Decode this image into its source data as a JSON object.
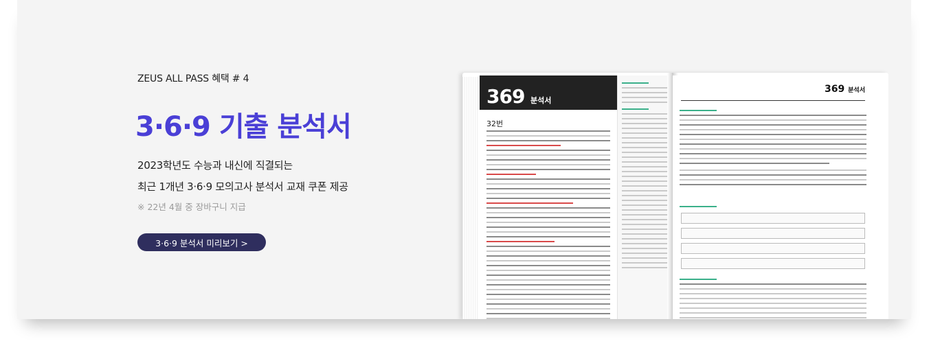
{
  "banner": {
    "label": "ZEUS ALL PASS 혜택  # 4",
    "title": "3·6·9 기출 분석서",
    "desc_line1": "2023학년도 수능과 내신에 직결되는",
    "desc_line2": "최근 1개년 3·6·9 모의고사 분석서 교재 쿠폰 제공",
    "note": "※ 22년 4월 중 장바구니 지급",
    "button_label": "3·6·9 분석서 미리보기 >"
  },
  "book": {
    "left_header_number": "369",
    "left_header_sub": "분석서",
    "question_no": "32번",
    "right_header_number": "369",
    "right_header_sub": "분석서"
  },
  "colors": {
    "title": "#4a3fd6",
    "button_bg": "#2f2e5e",
    "accent_green": "#3ab08a"
  }
}
